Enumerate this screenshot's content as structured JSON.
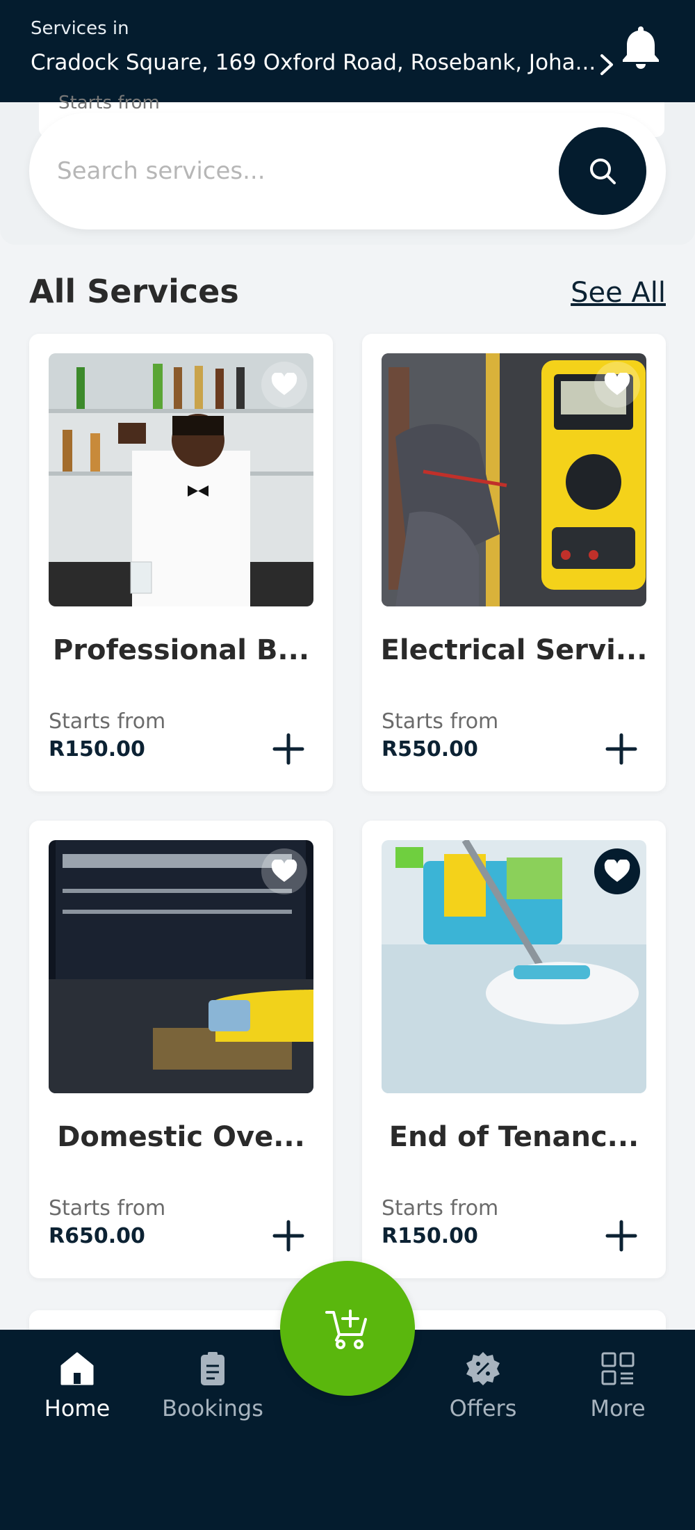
{
  "header": {
    "label": "Services in",
    "address": "Cradock Square, 169 Oxford Road, Rosebank, Joha...",
    "chevron_icon": "chevron-right-icon",
    "bell_icon": "bell-icon"
  },
  "search": {
    "behind_text": "Starts from",
    "placeholder": "Search services...",
    "button_icon": "search-icon"
  },
  "section": {
    "title": "All Services",
    "see_all": "See All"
  },
  "services": [
    {
      "name": "Professional B...",
      "starts_label": "Starts from",
      "price": "R150.00",
      "favorited": false
    },
    {
      "name": "Electrical Servi...",
      "starts_label": "Starts from",
      "price": "R550.00",
      "favorited": false
    },
    {
      "name": "Domestic Ove...",
      "starts_label": "Starts from",
      "price": "R650.00",
      "favorited": false
    },
    {
      "name": "End of Tenanc...",
      "starts_label": "Starts from",
      "price": "R150.00",
      "favorited": true
    }
  ],
  "nav": {
    "home": "Home",
    "bookings": "Bookings",
    "offers": "Offers",
    "more": "More",
    "cart_icon": "cart-plus-icon"
  },
  "colors": {
    "primary": "#041c2e",
    "accent": "#5ab70d",
    "background": "#f2f4f6"
  }
}
